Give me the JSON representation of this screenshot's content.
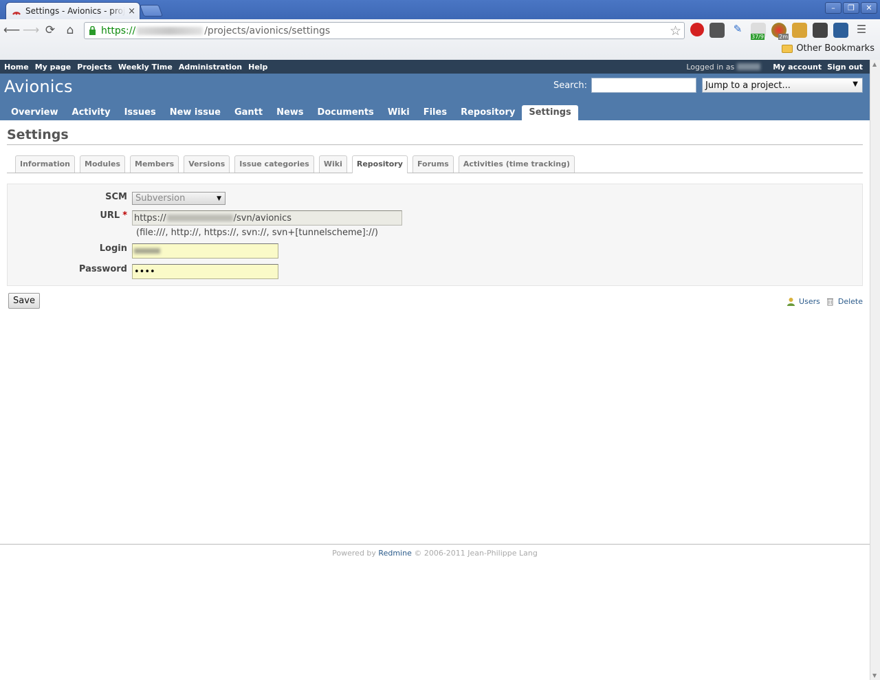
{
  "browser": {
    "tab_title": "Settings - Avionics - project",
    "tab_close": "×",
    "window_buttons": [
      "–",
      "❐",
      "✕"
    ],
    "url_scheme": "https://",
    "url_path": "/projects/avionics/settings",
    "bookmarks_folder": "Other Bookmarks",
    "ext_badges": [
      "37/9",
      "2m"
    ]
  },
  "top_menu": {
    "items": [
      "Home",
      "My page",
      "Projects",
      "Weekly Time",
      "Administration",
      "Help"
    ],
    "logged_in_as": "Logged in as",
    "my_account": "My account",
    "sign_out": "Sign out"
  },
  "header": {
    "project_title": "Avionics",
    "search_label": "Search:",
    "jump_label": "Jump to a project...",
    "jump_arrow": "▼"
  },
  "main_menu": {
    "items": [
      "Overview",
      "Activity",
      "Issues",
      "New issue",
      "Gantt",
      "News",
      "Documents",
      "Wiki",
      "Files",
      "Repository",
      "Settings"
    ],
    "selected": "Settings"
  },
  "content": {
    "heading": "Settings",
    "tabs": [
      "Information",
      "Modules",
      "Members",
      "Versions",
      "Issue categories",
      "Wiki",
      "Repository",
      "Forums",
      "Activities (time tracking)"
    ],
    "selected_tab": "Repository"
  },
  "form": {
    "scm_label": "SCM",
    "scm_value": "Subversion",
    "url_label": "URL",
    "required_mark": "*",
    "url_prefix": "https://",
    "url_suffix": "/svn/avionics",
    "url_hint": "(file:///, http://, https://, svn://, svn+[tunnelscheme]://)",
    "login_label": "Login",
    "password_label": "Password",
    "password_value": "••••",
    "save_label": "Save"
  },
  "contextual": {
    "users_label": "Users",
    "delete_label": "Delete"
  },
  "footer": {
    "powered_by": "Powered by",
    "redmine": "Redmine",
    "copyright": "© 2006-2011 Jean-Philippe Lang"
  }
}
